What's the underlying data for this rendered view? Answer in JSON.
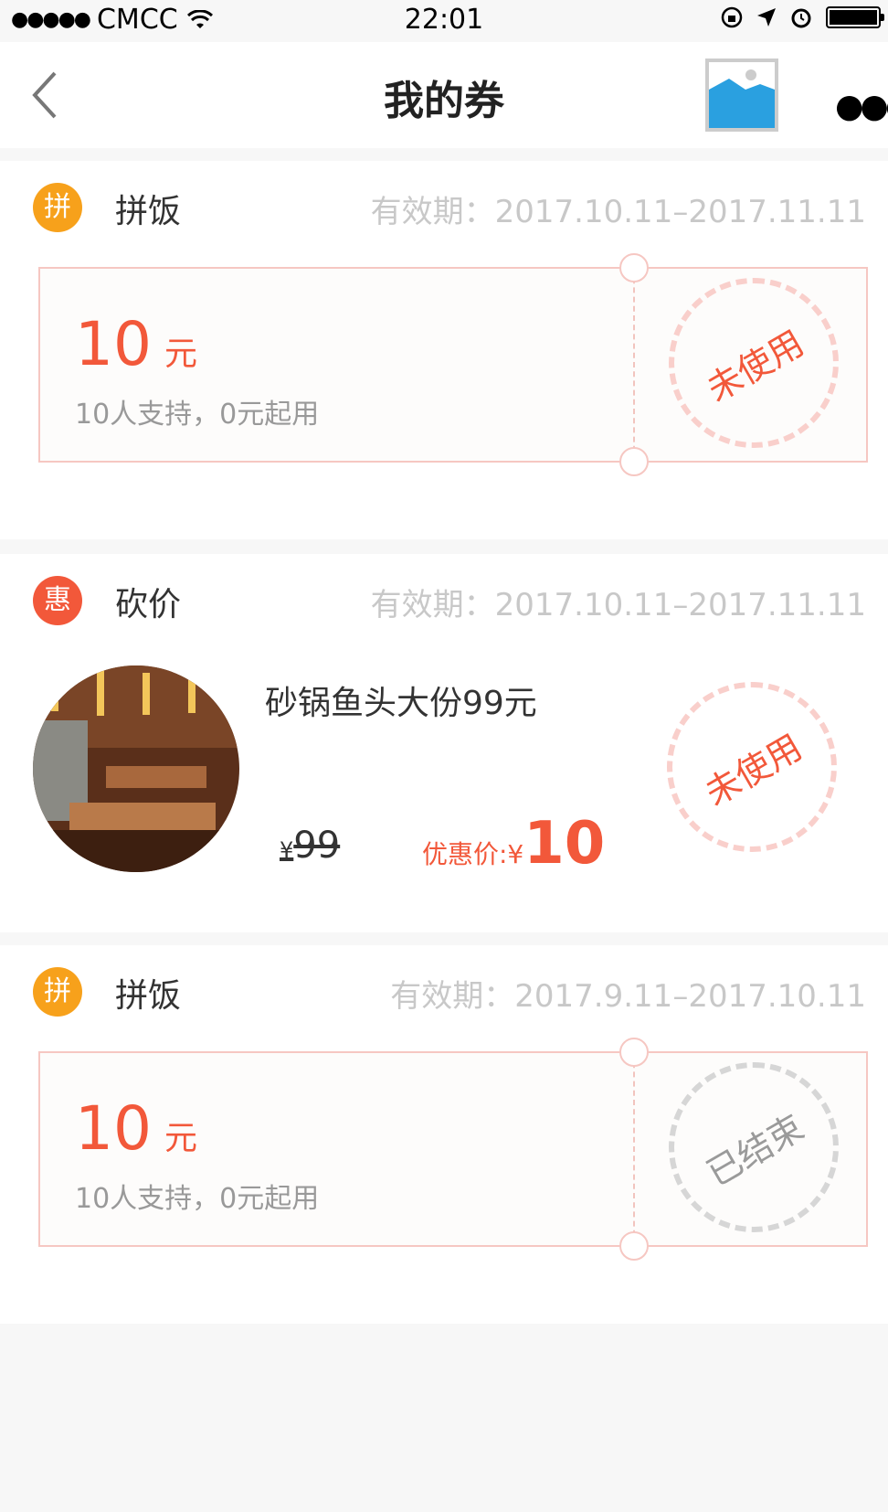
{
  "status_bar": {
    "signal": "●●●●●",
    "carrier": "CMCC",
    "time": "22:01",
    "battery_level": 1.0
  },
  "nav": {
    "title": "我的券",
    "back_icon": "chevron-left-icon",
    "more_icon": "more-dots-icon",
    "thumb_icon": "image-placeholder-icon"
  },
  "coupons": [
    {
      "badge": "拼",
      "type": "拼饭",
      "validity": "有效期：2017.10.11–2017.11.11",
      "amount": "10",
      "unit": "元",
      "support": "10人支持，0元起用",
      "status": "未使用"
    },
    {
      "badge": "惠",
      "type": "砍价",
      "validity": "有效期：2017.10.11–2017.11.11",
      "title": "砂锅鱼头大份99元",
      "old_price_symbol": "¥",
      "old_price": "99",
      "promo_label": "优惠价:¥",
      "promo_price": "10",
      "status": "未使用"
    },
    {
      "badge": "拼",
      "type": "拼饭",
      "validity": "有效期：2017.9.11–2017.10.11",
      "amount": "10",
      "unit": "元",
      "support": "10人支持，0元起用",
      "status": "已结束"
    }
  ],
  "colors": {
    "accent": "#f2583a",
    "badge_orange": "#f7a11b",
    "muted": "#c8c8c8"
  }
}
